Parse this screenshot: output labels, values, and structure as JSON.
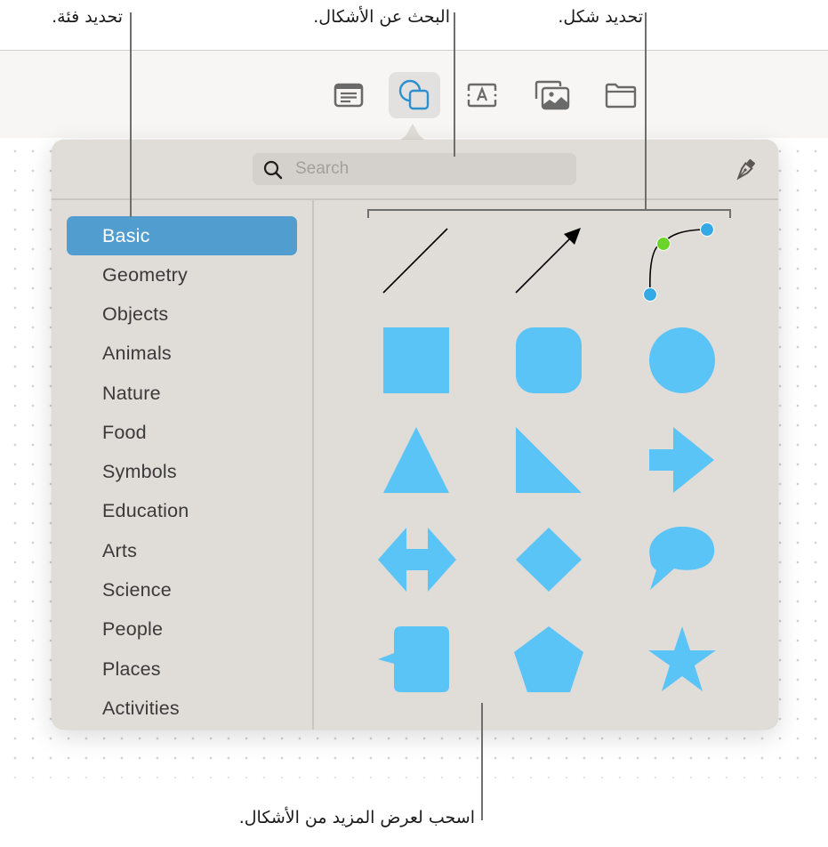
{
  "callouts": {
    "select_category": "تحديد فئة.",
    "search_shapes": "البحث عن الأشكال.",
    "select_shape": "تحديد شكل.",
    "drag_more": "اسحب لعرض المزيد من الأشكال."
  },
  "toolbar": {
    "buttons": [
      {
        "name": "text-box",
        "icon": "text-box-icon",
        "active": false
      },
      {
        "name": "shapes",
        "icon": "shapes-icon",
        "active": true
      },
      {
        "name": "text",
        "icon": "text-field-icon",
        "active": false
      },
      {
        "name": "media",
        "icon": "photo-library-icon",
        "active": false
      },
      {
        "name": "files",
        "icon": "folder-icon",
        "active": false
      }
    ]
  },
  "search": {
    "placeholder": "Search",
    "value": ""
  },
  "draw_tool": {
    "icon": "pen-icon"
  },
  "categories": {
    "selected": "Basic",
    "items": [
      "Basic",
      "Geometry",
      "Objects",
      "Animals",
      "Nature",
      "Food",
      "Symbols",
      "Education",
      "Arts",
      "Science",
      "People",
      "Places",
      "Activities"
    ]
  },
  "shapes": [
    [
      "line",
      "arrow-line",
      "curve"
    ],
    [
      "square",
      "rounded-square",
      "circle"
    ],
    [
      "triangle",
      "right-triangle",
      "arrow"
    ],
    [
      "double-arrow",
      "diamond",
      "speech-bubble"
    ],
    [
      "callout-square",
      "pentagon",
      "star"
    ]
  ],
  "colors": {
    "accent": "#529dd0",
    "shape_fill": "#5bc4f7",
    "active_icon": "#2d8fd0",
    "curve_handle_end": "#33aae6",
    "curve_handle_mid": "#6bd42a"
  }
}
